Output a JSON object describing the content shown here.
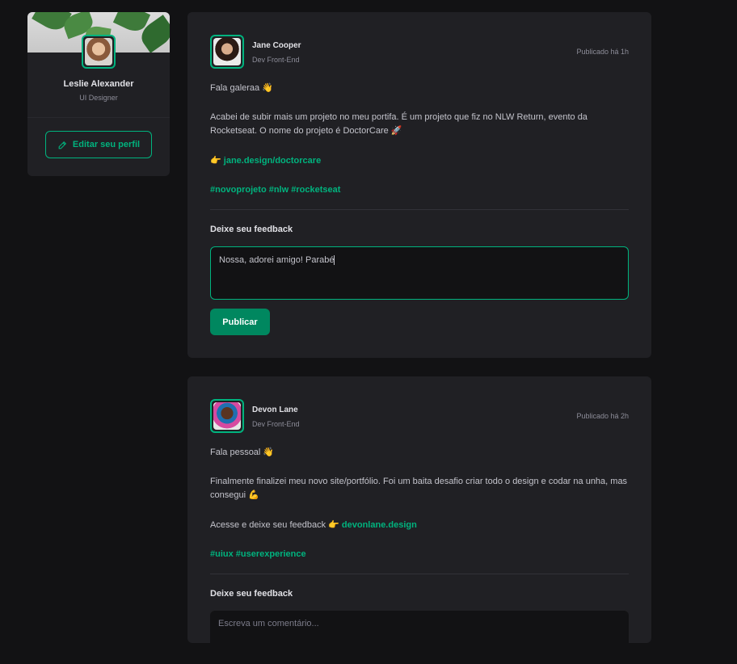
{
  "sidebar": {
    "name": "Leslie Alexander",
    "role": "UI Designer",
    "edit_label": "Editar seu perfil"
  },
  "posts": [
    {
      "author": "Jane Cooper",
      "role": "Dev Front-End",
      "published": "Publicado há 1h",
      "p1": "Fala galeraa 👋",
      "p2": "Acabei de subir mais um projeto no meu portifa. É um projeto que fiz no NLW Return, evento da Rocketseat. O nome do projeto é DoctorCare 🚀",
      "link_prefix": "👉 ",
      "link": "jane.design/doctorcare",
      "tags": "#novoprojeto #nlw #rocketseat",
      "feedback_title": "Deixe seu feedback",
      "comment_value": "Nossa, adorei amigo! Parabé",
      "publish_label": "Publicar"
    },
    {
      "author": "Devon Lane",
      "role": "Dev Front-End",
      "published": "Publicado há 2h",
      "p1": "Fala pessoal 👋",
      "p2": "Finalmente finalizei meu novo site/portfólio. Foi um baita desafio criar todo o design e codar na unha, mas consegui 💪",
      "p3_prefix": "Acesse e deixe seu feedback 👉 ",
      "link": "devonlane.design",
      "tags": "#uiux #userexperience",
      "feedback_title": "Deixe seu feedback",
      "comment_placeholder": "Escreva um comentário..."
    }
  ],
  "colors": {
    "accent": "#00b37e",
    "button": "#00875f",
    "card": "#202024",
    "background": "#121214"
  },
  "icons": {
    "edit": "pencil-icon"
  }
}
